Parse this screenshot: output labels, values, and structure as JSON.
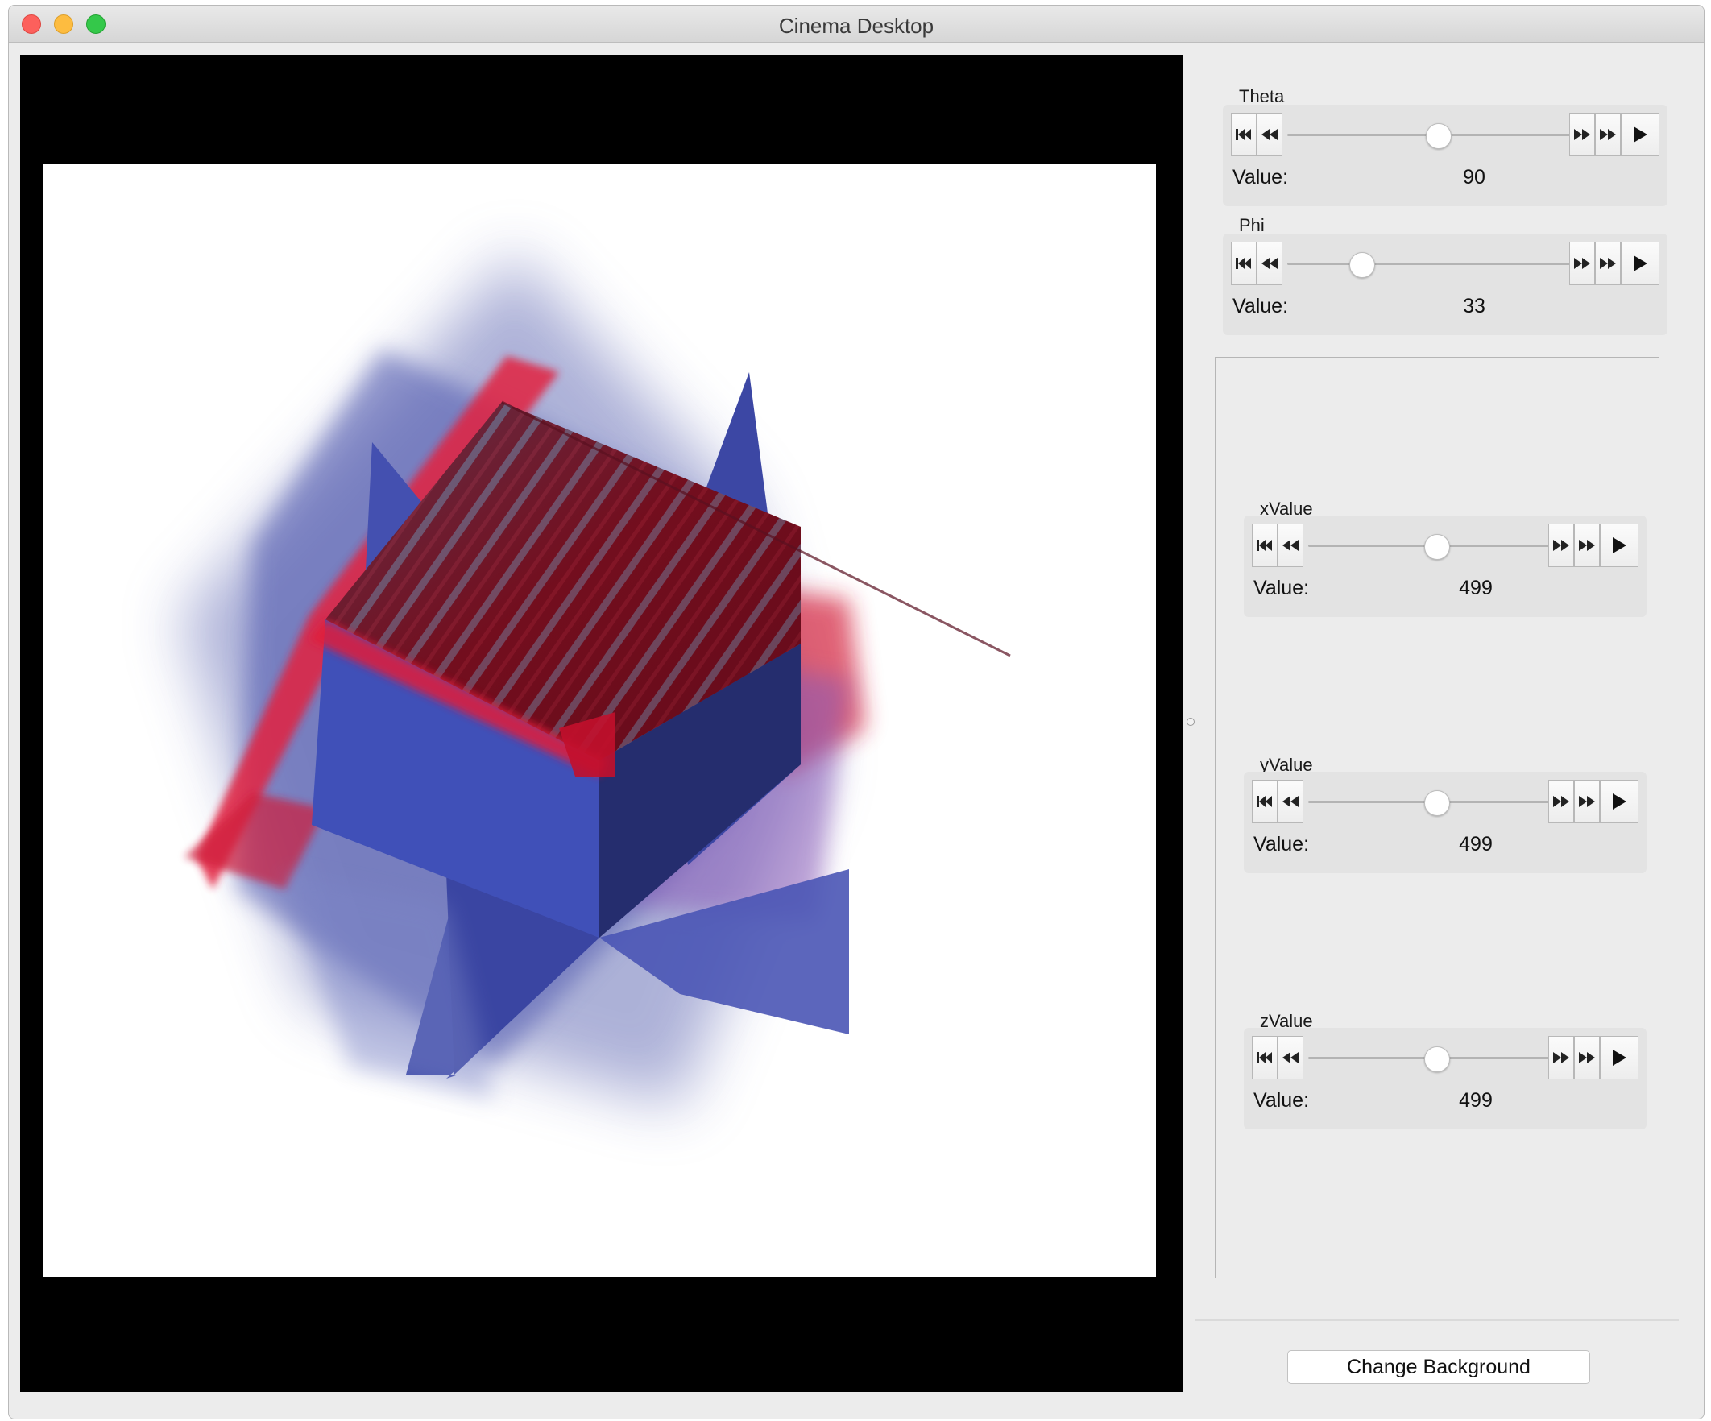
{
  "window": {
    "title": "Cinema Desktop"
  },
  "camera_controls": [
    {
      "label": "Theta",
      "value_label": "Value:",
      "value": "90",
      "level": 0.55
    },
    {
      "label": "Phi",
      "value_label": "Value:",
      "value": "33",
      "level": 0.23
    }
  ],
  "parameter_controls": [
    {
      "label": "xValue",
      "value_label": "Value:",
      "value": "499",
      "level": 0.5
    },
    {
      "label": "yValue",
      "value_label": "Value:",
      "value": "499",
      "level": 0.5
    },
    {
      "label": "zValue",
      "value_label": "Value:",
      "value": "499",
      "level": 0.5
    }
  ],
  "icons": [
    "first-frame-icon",
    "step-back-icon",
    "step-forward-icon",
    "last-frame-icon",
    "play-icon"
  ],
  "buttons": {
    "change_background": "Change Background"
  },
  "colors": {
    "viewer_background": "#000000",
    "render_background": "#ffffff",
    "slice_blue": "#3f4aa8",
    "data_red": "#c0102a"
  }
}
